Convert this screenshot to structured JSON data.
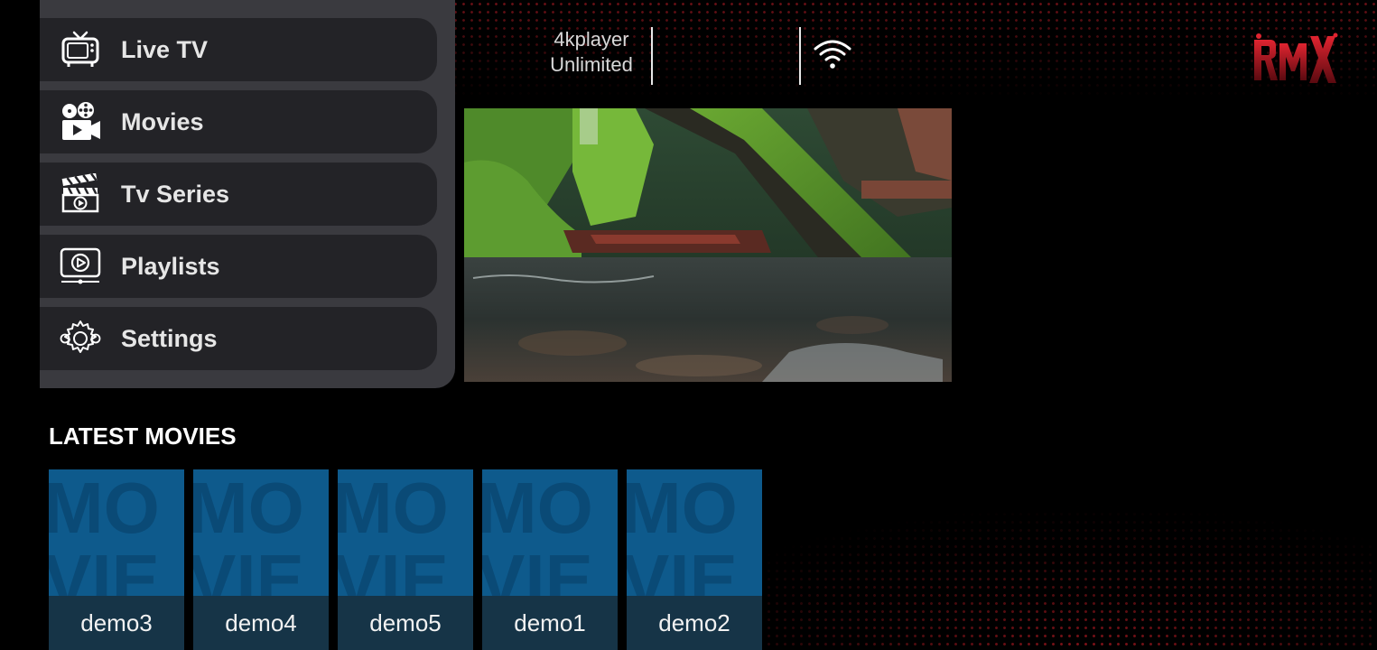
{
  "menu": {
    "items": [
      {
        "label": "Live TV",
        "icon": "tv-icon"
      },
      {
        "label": "Movies",
        "icon": "film-camera-icon"
      },
      {
        "label": "Tv Series",
        "icon": "clapperboard-icon"
      },
      {
        "label": "Playlists",
        "icon": "playlist-icon"
      },
      {
        "label": "Settings",
        "icon": "gear-icon"
      }
    ]
  },
  "header": {
    "account_line1": "4kplayer",
    "account_line2": "Unlimited",
    "wifi_icon": "wifi-icon",
    "logo": "RMX"
  },
  "latest": {
    "title": "LATEST MOVIES",
    "movies": [
      {
        "title": "demo3"
      },
      {
        "title": "demo4"
      },
      {
        "title": "demo5"
      },
      {
        "title": "demo1"
      },
      {
        "title": "demo2"
      }
    ]
  },
  "colors": {
    "accent": "#c41a24",
    "card_blue": "#0e5a8c",
    "card_label_bg": "#163447",
    "menu_item_bg": "#232327",
    "menu_panel_bg": "#3a3a3f"
  }
}
